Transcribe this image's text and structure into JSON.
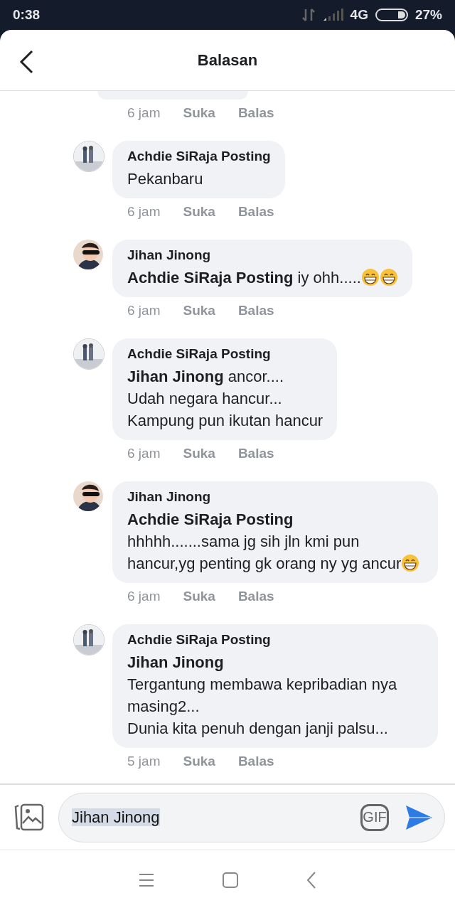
{
  "status_bar": {
    "time": "0:38",
    "network": "4G",
    "battery": "27%"
  },
  "header": {
    "title": "Balasan"
  },
  "comments": [
    {
      "kind": "tail",
      "time": "6 jam",
      "like": "Suka",
      "reply": "Balas"
    },
    {
      "kind": "comment",
      "author": "Achdie SiRaja Posting",
      "text": "Pekanbaru",
      "time": "6 jam",
      "like": "Suka",
      "reply": "Balas"
    },
    {
      "kind": "comment",
      "author": "Jihan Jinong",
      "text": "**Achdie SiRaja Posting** iy ohh.....",
      "emoji": [
        {
          "kind": "grin"
        },
        {
          "kind": "grin"
        }
      ],
      "time": "6 jam",
      "like": "Suka",
      "reply": "Balas"
    },
    {
      "kind": "comment",
      "author": "Achdie SiRaja Posting",
      "text": "**Jihan Jinong** ancor....\nUdah negara hancur...\nKampung pun ikutan hancur",
      "time": "6 jam",
      "like": "Suka",
      "reply": "Balas"
    },
    {
      "kind": "comment",
      "author": "Jihan Jinong",
      "text": "**Achdie SiRaja Posting**\nhhhhh.......sama jg sih jln kmi pun hancur,yg penting gk orang ny yg ancur",
      "emoji": [
        {
          "kind": "grin"
        }
      ],
      "time": "6 jam",
      "like": "Suka",
      "reply": "Balas"
    },
    {
      "kind": "comment",
      "author": "Achdie SiRaja Posting",
      "text": "**Jihan Jinong**\nTergantung membawa kepribadian nya masing2...\nDunia kita penuh dengan janji palsu...",
      "time": "5 jam",
      "like": "Suka",
      "reply": "Balas"
    }
  ],
  "composer": {
    "value": "Jihan Jinong",
    "gif": "GIF"
  }
}
